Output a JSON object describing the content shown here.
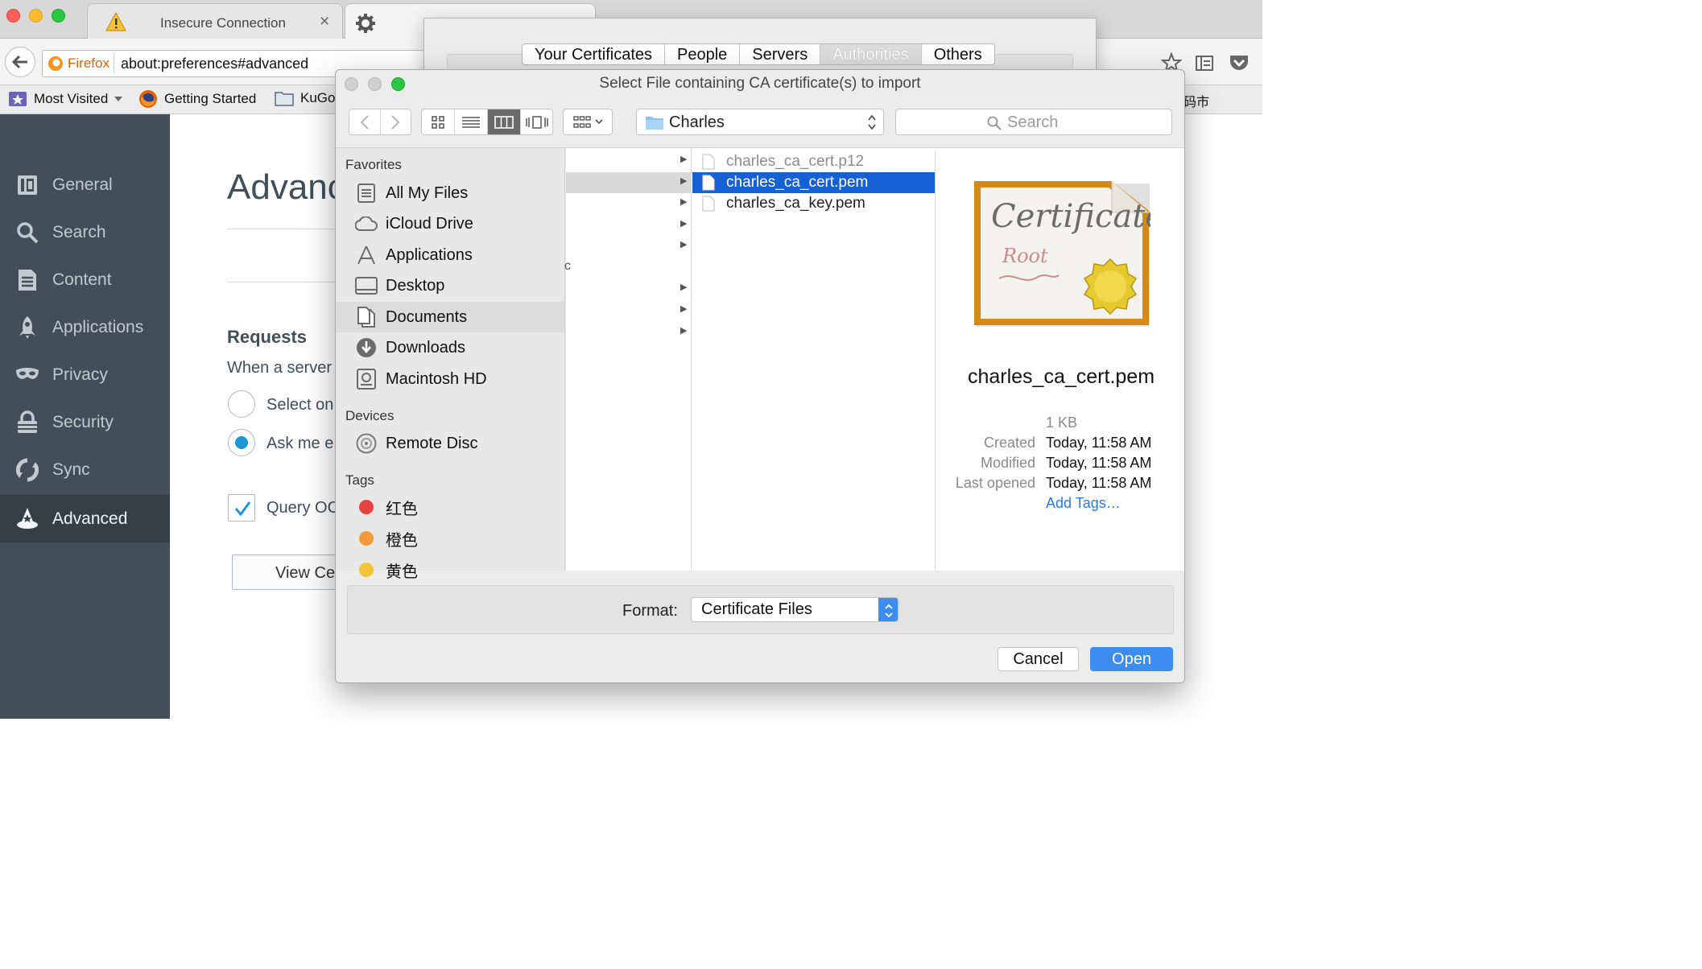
{
  "browser": {
    "tabs": [
      {
        "label": "Insecure Connection",
        "close": "×"
      },
      {
        "label": "Preferences"
      }
    ],
    "identity_label": "Firefox",
    "url": "about:preferences#advanced",
    "bookmarks": [
      {
        "label": "Most Visited"
      },
      {
        "label": "Getting Started"
      },
      {
        "label": "KuGo"
      }
    ],
    "bookmark_overflow": "码市"
  },
  "prefs": {
    "sidebar": [
      {
        "label": "General",
        "icon": "general-icon"
      },
      {
        "label": "Search",
        "icon": "search-icon"
      },
      {
        "label": "Content",
        "icon": "content-icon"
      },
      {
        "label": "Applications",
        "icon": "applications-icon"
      },
      {
        "label": "Privacy",
        "icon": "privacy-icon"
      },
      {
        "label": "Security",
        "icon": "security-icon"
      },
      {
        "label": "Sync",
        "icon": "sync-icon"
      },
      {
        "label": "Advanced",
        "icon": "advanced-icon",
        "active": true
      }
    ],
    "title": "Advanc",
    "requests_heading": "Requests",
    "requests_text": "When a server",
    "radio_select": "Select on",
    "radio_ask": "Ask me e",
    "query_label": "Query OC",
    "view_button": "View Ce"
  },
  "cert_manager": {
    "tabs": [
      "Your Certificates",
      "People",
      "Servers",
      "Authorities",
      "Others"
    ],
    "active_tab": "Authorities"
  },
  "file_dialog": {
    "title": "Select File containing CA certificate(s) to import",
    "location": "Charles",
    "search_placeholder": "Search",
    "favorites_heading": "Favorites",
    "favorites": [
      {
        "label": "All My Files",
        "icon": "all-files-icon"
      },
      {
        "label": "iCloud Drive",
        "icon": "cloud-icon"
      },
      {
        "label": "Applications",
        "icon": "applications-icon"
      },
      {
        "label": "Desktop",
        "icon": "desktop-icon"
      },
      {
        "label": "Documents",
        "icon": "documents-icon",
        "selected": true
      },
      {
        "label": "Downloads",
        "icon": "downloads-icon"
      },
      {
        "label": "Macintosh HD",
        "icon": "disk-icon"
      }
    ],
    "devices_heading": "Devices",
    "devices": [
      {
        "label": "Remote Disc",
        "icon": "disc-icon"
      }
    ],
    "tags_heading": "Tags",
    "tags": [
      {
        "label": "红色",
        "color": "#e94040"
      },
      {
        "label": "橙色",
        "color": "#f39a3a"
      },
      {
        "label": "黄色",
        "color": "#f3c43a"
      }
    ],
    "column1_fragment": "c",
    "files": [
      {
        "name": "charles_ca_cert.p12",
        "dimmed": true
      },
      {
        "name": "charles_ca_cert.pem",
        "selected": true
      },
      {
        "name": "charles_ca_key.pem"
      }
    ],
    "preview": {
      "cert_word": "Certificate",
      "cert_sub": "Root",
      "filename": "charles_ca_cert.pem",
      "size": "1 KB",
      "created_label": "Created",
      "created": "Today, 11:58 AM",
      "modified_label": "Modified",
      "modified": "Today, 11:58 AM",
      "opened_label": "Last opened",
      "opened": "Today, 11:58 AM",
      "add_tags": "Add Tags…"
    },
    "format_label": "Format:",
    "format_value": "Certificate Files",
    "cancel": "Cancel",
    "open": "Open",
    "accent": "#1560d4"
  }
}
